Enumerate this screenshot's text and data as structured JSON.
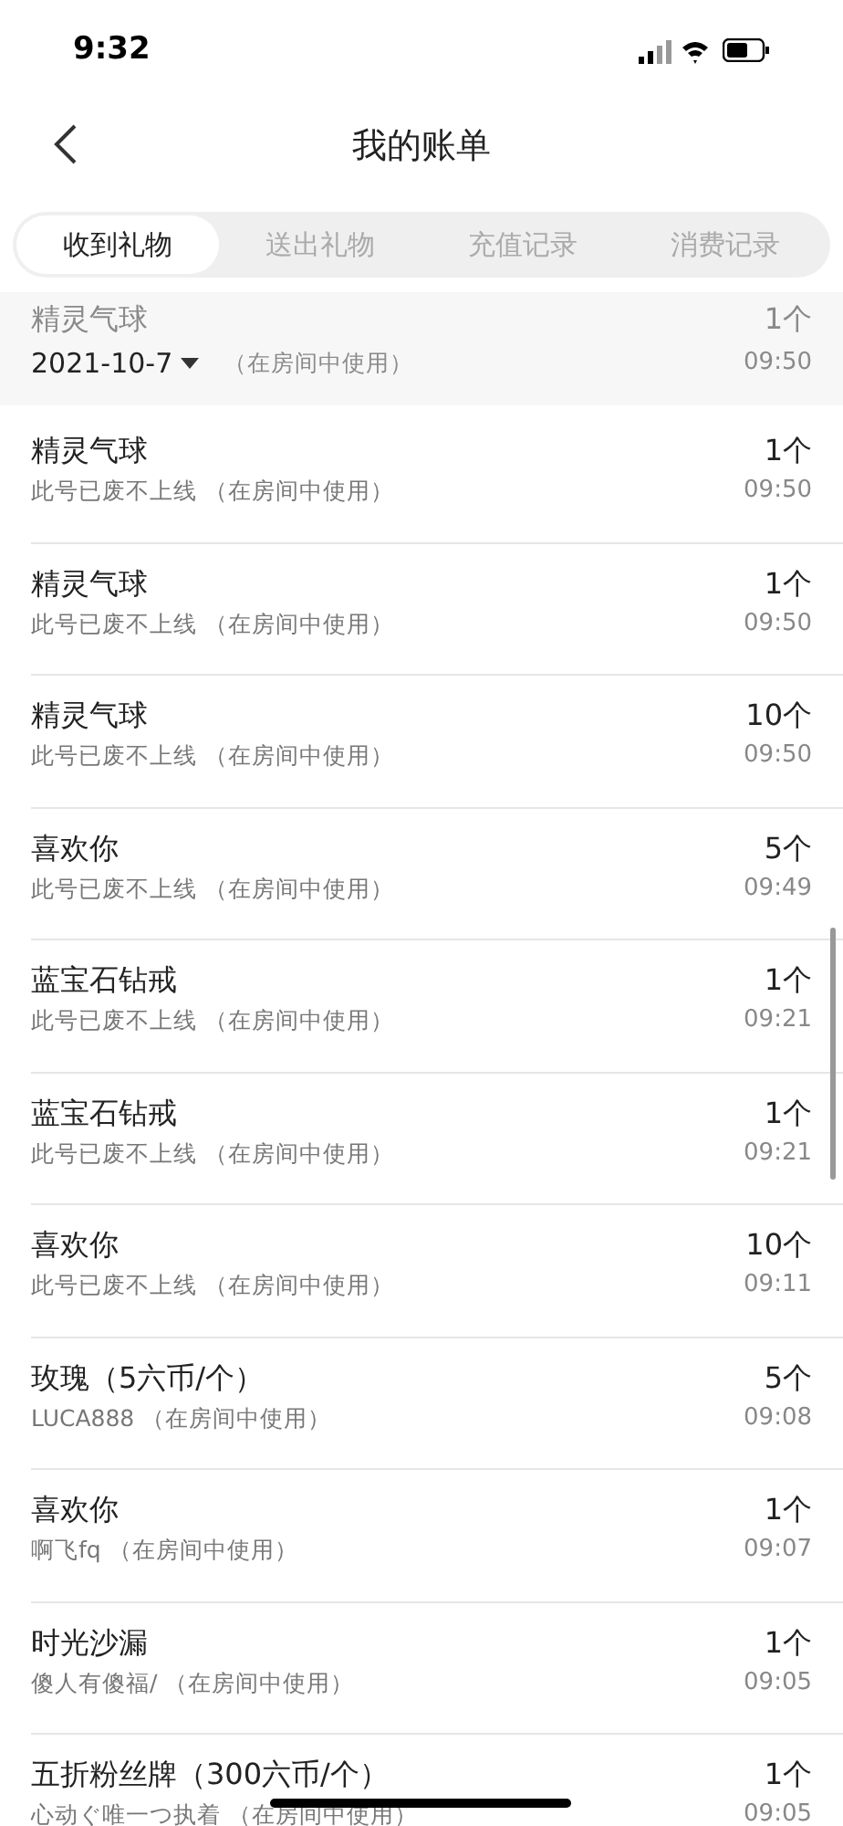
{
  "status_bar": {
    "time": "9:32"
  },
  "header": {
    "title": "我的账单"
  },
  "tabs": [
    {
      "label": "收到礼物",
      "selected": true
    },
    {
      "label": "送出礼物",
      "selected": false
    },
    {
      "label": "充值记录",
      "selected": false
    },
    {
      "label": "消费记录",
      "selected": false
    }
  ],
  "sticky_row": {
    "date": "2021-10-7",
    "name": "精灵气球",
    "detail": "（在房间中使用）",
    "count": "1个",
    "time": "09:50"
  },
  "records": [
    {
      "name": "精灵气球",
      "detail": "此号已废不上线 （在房间中使用）",
      "count": "1个",
      "time": "09:50"
    },
    {
      "name": "精灵气球",
      "detail": "此号已废不上线 （在房间中使用）",
      "count": "1个",
      "time": "09:50"
    },
    {
      "name": "精灵气球",
      "detail": "此号已废不上线 （在房间中使用）",
      "count": "10个",
      "time": "09:50"
    },
    {
      "name": "喜欢你",
      "detail": "此号已废不上线 （在房间中使用）",
      "count": "5个",
      "time": "09:49"
    },
    {
      "name": "蓝宝石钻戒",
      "detail": "此号已废不上线 （在房间中使用）",
      "count": "1个",
      "time": "09:21"
    },
    {
      "name": "蓝宝石钻戒",
      "detail": "此号已废不上线 （在房间中使用）",
      "count": "1个",
      "time": "09:21"
    },
    {
      "name": "喜欢你",
      "detail": "此号已废不上线 （在房间中使用）",
      "count": "10个",
      "time": "09:11"
    },
    {
      "name": "玫瑰（5六币/个）",
      "detail": "LUCA888 （在房间中使用）",
      "count": "5个",
      "time": "09:08"
    },
    {
      "name": "喜欢你",
      "detail": "啊飞fq （在房间中使用）",
      "count": "1个",
      "time": "09:07"
    },
    {
      "name": "时光沙漏",
      "detail": "傻人有傻福/ （在房间中使用）",
      "count": "1个",
      "time": "09:05"
    },
    {
      "name": "五折粉丝牌（300六币/个）",
      "detail": "心动ぐ唯一つ执着 （在房间中使用）",
      "count": "1个",
      "time": "09:05"
    }
  ]
}
